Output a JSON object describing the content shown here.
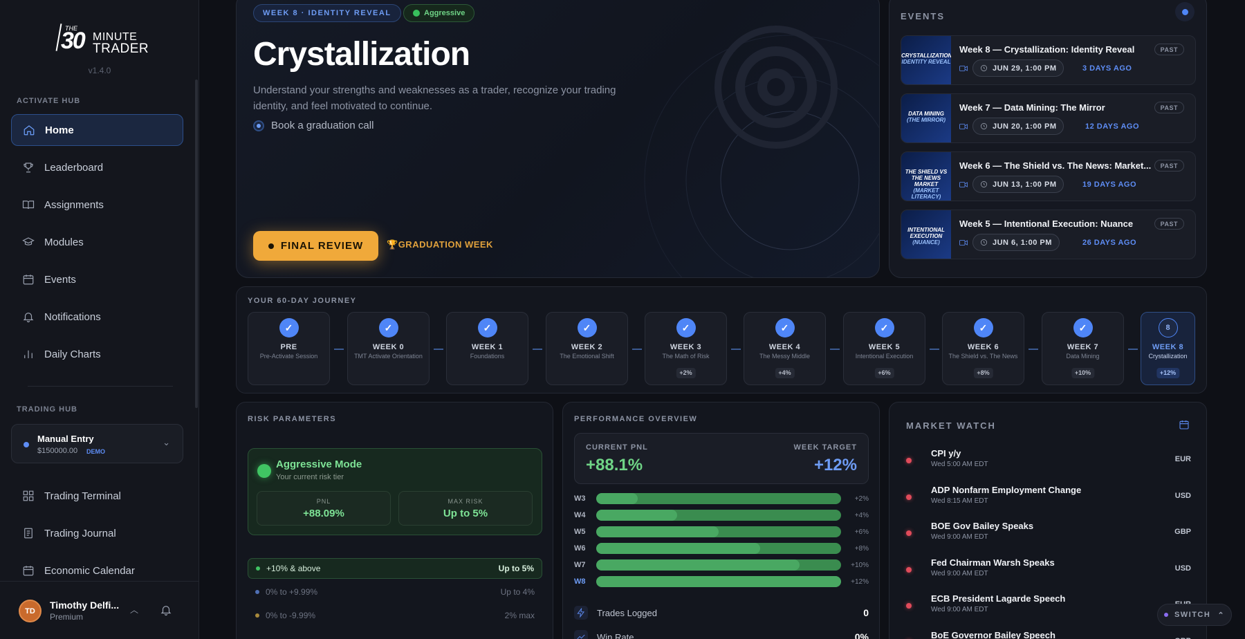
{
  "brand": {
    "the": "THE",
    "number": "30",
    "word1": "MINUTE",
    "word2": "TRADER",
    "version": "v1.4.0"
  },
  "sidebar": {
    "activate_label": "ACTIVATE HUB",
    "activate_items": [
      {
        "label": "Home",
        "icon": "home-icon"
      },
      {
        "label": "Leaderboard",
        "icon": "trophy-icon"
      },
      {
        "label": "Assignments",
        "icon": "book-icon"
      },
      {
        "label": "Modules",
        "icon": "graduation-cap-icon"
      },
      {
        "label": "Events",
        "icon": "calendar-icon"
      },
      {
        "label": "Notifications",
        "icon": "bell-icon"
      },
      {
        "label": "Daily Charts",
        "icon": "bar-chart-icon"
      }
    ],
    "trading_label": "TRADING HUB",
    "account": {
      "name": "Manual Entry",
      "balance": "$150000.00",
      "tag": "DEMO"
    },
    "trading_items": [
      {
        "label": "Trading Terminal",
        "icon": "grid-icon"
      },
      {
        "label": "Trading Journal",
        "icon": "journal-icon"
      },
      {
        "label": "Economic Calendar",
        "icon": "calendar-icon"
      }
    ],
    "user": {
      "initials": "TD",
      "name": "Timothy Delfi...",
      "role": "Premium"
    }
  },
  "hero": {
    "week_pill": "WEEK 8 · IDENTITY REVEAL",
    "mode_pill": "Aggressive",
    "title": "Crystallization",
    "description": "Understand your strengths and weaknesses as a trader, recognize your trading identity, and feel motivated to continue.",
    "task": "Book a graduation call",
    "button": "FINAL REVIEW",
    "badge": "GRADUATION WEEK"
  },
  "events": {
    "header": "EVENTS",
    "items": [
      {
        "title": "Week 8 — Crystallization: Identity Reveal",
        "date": "JUN 29, 1:00 PM",
        "ago": "3 DAYS AGO",
        "status": "PAST",
        "thumb_top": "CRYSTALLIZATION",
        "thumb_bottom": "IDENTITY REVEAL"
      },
      {
        "title": "Week 7 — Data Mining: The Mirror",
        "date": "JUN 20, 1:00 PM",
        "ago": "12 DAYS AGO",
        "status": "PAST",
        "thumb_top": "DATA MINING",
        "thumb_bottom": "(THE MIRROR)"
      },
      {
        "title": "Week 6 — The Shield vs. The News: Market...",
        "date": "JUN 13, 1:00 PM",
        "ago": "19 DAYS AGO",
        "status": "PAST",
        "thumb_top": "THE SHIELD VS THE NEWS MARKET",
        "thumb_bottom": "(MARKET LITERACY)"
      },
      {
        "title": "Week 5 — Intentional Execution: Nuance",
        "date": "JUN 6, 1:00 PM",
        "ago": "26 DAYS AGO",
        "status": "PAST",
        "thumb_top": "INTENTIONAL EXECUTION",
        "thumb_bottom": "(NUANCE)"
      }
    ]
  },
  "journey": {
    "header": "YOUR 60-DAY JOURNEY",
    "steps": [
      {
        "week": "PRE",
        "sub": "Pre-Activate Session",
        "tag": "",
        "done": true
      },
      {
        "week": "WEEK 0",
        "sub": "TMT Activate Orientation",
        "tag": "",
        "done": true
      },
      {
        "week": "WEEK 1",
        "sub": "Foundations",
        "tag": "",
        "done": true
      },
      {
        "week": "WEEK 2",
        "sub": "The Emotional Shift",
        "tag": "",
        "done": true
      },
      {
        "week": "WEEK 3",
        "sub": "The Math of Risk",
        "tag": "+2%",
        "done": true
      },
      {
        "week": "WEEK 4",
        "sub": "The Messy Middle",
        "tag": "+4%",
        "done": true
      },
      {
        "week": "WEEK 5",
        "sub": "Intentional Execution",
        "tag": "+6%",
        "done": true
      },
      {
        "week": "WEEK 6",
        "sub": "The Shield vs. The News",
        "tag": "+8%",
        "done": true
      },
      {
        "week": "WEEK 7",
        "sub": "Data Mining",
        "tag": "+10%",
        "done": true
      },
      {
        "week": "WEEK 8",
        "sub": "Crystallization",
        "tag": "+12%",
        "done": false,
        "num": "8"
      }
    ]
  },
  "risk": {
    "header": "RISK PARAMETERS",
    "mode": "Aggressive Mode",
    "mode_sub": "Your current risk tier",
    "pnl_label": "PNL",
    "pnl_value": "+88.09%",
    "max_label": "MAX RISK",
    "max_value": "Up to 5%",
    "tiers": [
      {
        "range": "+10% & above",
        "value": "Up to 5%",
        "color": "#40c463"
      },
      {
        "range": "0% to +9.99%",
        "value": "Up to 4%",
        "color": "#4f6fb5"
      },
      {
        "range": "0% to -9.99%",
        "value": "2% max",
        "color": "#a88a3c"
      }
    ]
  },
  "performance": {
    "header": "PERFORMANCE OVERVIEW",
    "current_label": "CURRENT PNL",
    "current_value": "+88.1%",
    "target_label": "WEEK TARGET",
    "target_value": "+12%",
    "bars": [
      {
        "week": "W3",
        "target": "+2%",
        "progress": 0.17
      },
      {
        "week": "W4",
        "target": "+4%",
        "progress": 0.33
      },
      {
        "week": "W5",
        "target": "+6%",
        "progress": 0.5
      },
      {
        "week": "W6",
        "target": "+8%",
        "progress": 0.67
      },
      {
        "week": "W7",
        "target": "+10%",
        "progress": 0.83
      },
      {
        "week": "W8",
        "target": "+12%",
        "progress": 1.0,
        "current": true
      }
    ],
    "stats": [
      {
        "label": "Trades Logged",
        "value": "0"
      },
      {
        "label": "Win Rate",
        "value": "0%"
      }
    ]
  },
  "market": {
    "header": "MARKET WATCH",
    "items": [
      {
        "name": "CPI y/y",
        "time": "Wed 5:00 AM EDT",
        "cur": "EUR"
      },
      {
        "name": "ADP Nonfarm Employment Change",
        "time": "Wed 8:15 AM EDT",
        "cur": "USD"
      },
      {
        "name": "BOE Gov Bailey Speaks",
        "time": "Wed 9:00 AM EDT",
        "cur": "GBP"
      },
      {
        "name": "Fed Chairman Warsh Speaks",
        "time": "Wed 9:00 AM EDT",
        "cur": "USD"
      },
      {
        "name": "ECB President Lagarde Speech",
        "time": "Wed 9:00 AM EDT",
        "cur": "EUR"
      },
      {
        "name": "BoE Governor Bailey Speech",
        "time": "",
        "cur": "GBP"
      }
    ]
  },
  "switch_label": "SWITCH"
}
